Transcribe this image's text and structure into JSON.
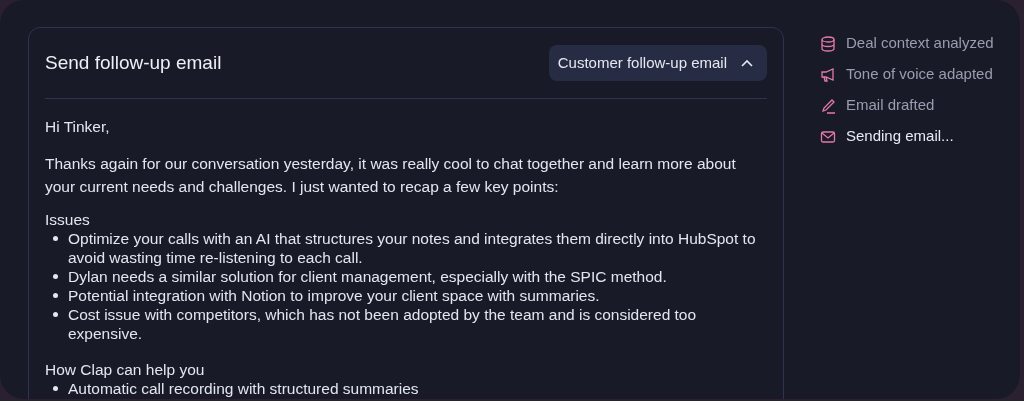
{
  "card": {
    "title": "Send follow-up email",
    "template_dropdown": {
      "label": "Customer follow-up email",
      "expanded": true
    },
    "email": {
      "greeting": "Hi Tinker,",
      "intro": "Thanks again for our conversation yesterday, it was really cool to chat together and learn more about your current needs and challenges. I just wanted to recap a few key points:",
      "sections": [
        {
          "heading": "Issues",
          "bullets": [
            "Optimize your calls with an AI that structures your notes and integrates them directly into HubSpot to avoid wasting time re-listening to each call.",
            "Dylan needs a similar solution for client management, especially with the SPIC method.",
            "Potential integration with Notion to improve your client space with summaries.",
            "Cost issue with competitors, which has not been adopted by the team and is considered too expensive."
          ]
        },
        {
          "heading": "How Clap can help you",
          "bullets": [
            "Automatic call recording with structured summaries"
          ]
        }
      ]
    }
  },
  "steps": [
    {
      "kind": "database",
      "label": "Deal context analyzed",
      "active": false
    },
    {
      "kind": "megaphone",
      "label": "Tone of voice adapted",
      "active": false
    },
    {
      "kind": "pen",
      "label": "Email drafted",
      "active": false
    },
    {
      "kind": "mail",
      "label": "Sending email...",
      "active": true
    }
  ]
}
